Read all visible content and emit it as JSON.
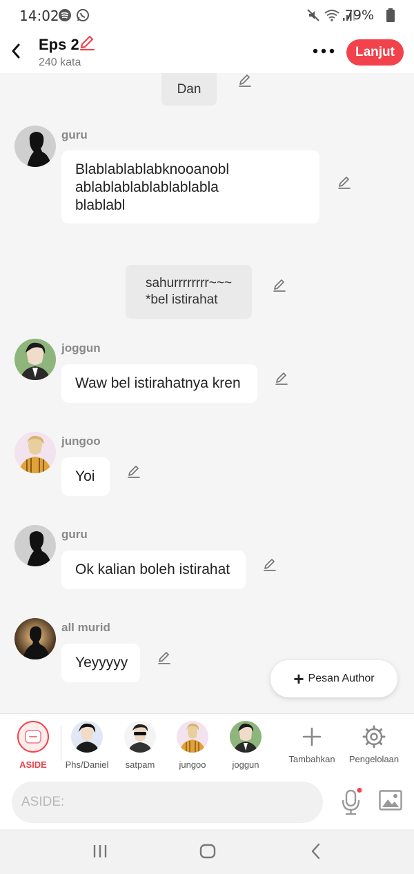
{
  "status_bar": {
    "time": "14:02",
    "battery": "79%"
  },
  "header": {
    "title": "Eps 2",
    "word_count": "240 kata",
    "next_label": "Lanjut"
  },
  "messages": {
    "narr_top": "Dan",
    "m1": {
      "sender": "guru",
      "lines": [
        "Blablablablabknooanobl",
        "ablablablablablablabla",
        "blablabl"
      ]
    },
    "narr_mid": [
      "sahurrrrrrrr~~~",
      "*bel istirahat"
    ],
    "m2": {
      "sender": "joggun",
      "text": "Waw bel istirahatnya kren"
    },
    "m3": {
      "sender": "jungoo",
      "text": "Yoi"
    },
    "m4": {
      "sender": "guru",
      "text": "Ok kalian boleh istirahat"
    },
    "m5": {
      "sender": "all murid",
      "text": "Yeyyyyy"
    }
  },
  "fab": {
    "label": "Pesan Author"
  },
  "character_bar": {
    "aside": "ASIDE",
    "characters": [
      "Phs/Daniel",
      "satpam",
      "jungoo",
      "joggun"
    ],
    "add_label": "Tambahkan",
    "manage_label": "Pengelolaan"
  },
  "composer": {
    "placeholder": "ASIDE:"
  },
  "colors": {
    "accent": "#f2424b",
    "background": "#f5f5f5",
    "bubble": "#ffffff",
    "narration": "#eaeaea"
  },
  "icons": [
    "back-icon",
    "edit-icon",
    "more-icon",
    "plus-icon",
    "gear-icon",
    "mic-icon",
    "image-icon",
    "recent-apps-icon",
    "home-icon",
    "back-nav-icon"
  ]
}
